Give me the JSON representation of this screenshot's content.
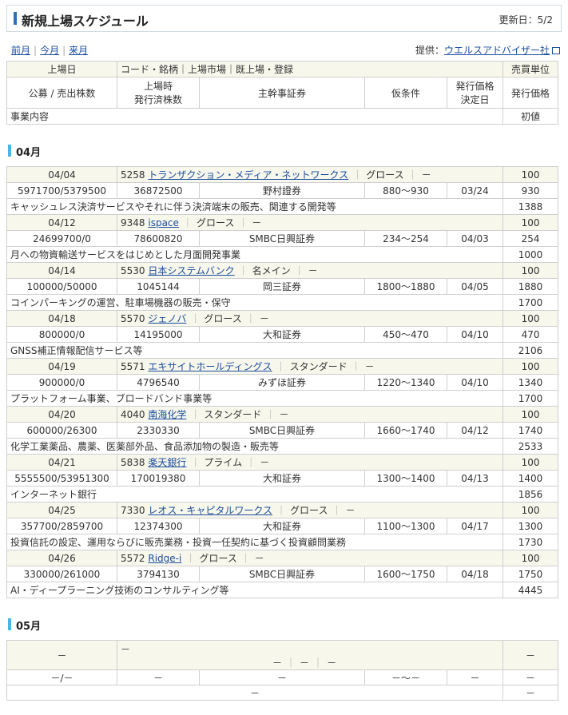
{
  "header": {
    "title": "新規上場スケジュール",
    "updated": "更新日：5/2"
  },
  "nav": {
    "prev": "前月",
    "current": "今月",
    "next": "来月",
    "sep": "|"
  },
  "provider": {
    "prefix": "提供：",
    "name": "ウエルスアドバイザー社"
  },
  "columns": {
    "listing_date": "上場日",
    "code_name": "コード・銘柄｜上場市場｜既上場・登録",
    "trade_unit": "売買単位",
    "offering": "公募 / 売出株数",
    "shares_line1": "上場時",
    "shares_line2": "発行済株数",
    "underwriter": "主幹事証券",
    "provisional": "仮条件",
    "decision_line1": "発行価格",
    "decision_line2": "決定日",
    "issue_price": "発行価格",
    "business": "事業内容",
    "first_price": "初値"
  },
  "months": [
    {
      "label": "04月",
      "ipos": [
        {
          "date": "04/04",
          "code": "5258",
          "name": "トランザクション・メディア・ネットワークス",
          "market": "グロース",
          "status": "－",
          "unit": "100",
          "offering": "5971700/5379500",
          "shares": "36872500",
          "underwriter": "野村證券",
          "range": "880～930",
          "decision": "03/24",
          "price": "930",
          "business": "キャッシュレス決済サービスやそれに伴う決済端末の販売、関連する開発等",
          "first": "1388"
        },
        {
          "date": "04/12",
          "code": "9348",
          "name": "ispace",
          "market": "グロース",
          "status": "－",
          "unit": "100",
          "offering": "24699700/0",
          "shares": "78600820",
          "underwriter": "SMBC日興証券",
          "range": "234～254",
          "decision": "04/03",
          "price": "254",
          "business": "月への物資輸送サービスをはじめとした月面開発事業",
          "first": "1000"
        },
        {
          "date": "04/14",
          "code": "5530",
          "name": "日本システムバンク",
          "market": "名メイン",
          "status": "－",
          "unit": "100",
          "offering": "100000/50000",
          "shares": "1045144",
          "underwriter": "岡三証券",
          "range": "1800～1880",
          "decision": "04/05",
          "price": "1880",
          "business": "コインパーキングの運営、駐車場機器の販売・保守",
          "first": "1700"
        },
        {
          "date": "04/18",
          "code": "5570",
          "name": "ジェノバ",
          "market": "グロース",
          "status": "－",
          "unit": "100",
          "offering": "800000/0",
          "shares": "14195000",
          "underwriter": "大和証券",
          "range": "450～470",
          "decision": "04/10",
          "price": "470",
          "business": "GNSS補正情報配信サービス等",
          "first": "2106"
        },
        {
          "date": "04/19",
          "code": "5571",
          "name": "エキサイトホールディングス",
          "market": "スタンダード",
          "status": "－",
          "unit": "100",
          "offering": "900000/0",
          "shares": "4796540",
          "underwriter": "みずほ証券",
          "range": "1220～1340",
          "decision": "04/10",
          "price": "1340",
          "business": "プラットフォーム事業、ブロードバンド事業等",
          "first": "1700"
        },
        {
          "date": "04/20",
          "code": "4040",
          "name": "南海化学",
          "market": "スタンダード",
          "status": "－",
          "unit": "100",
          "offering": "600000/26300",
          "shares": "2330330",
          "underwriter": "SMBC日興証券",
          "range": "1660～1740",
          "decision": "04/12",
          "price": "1740",
          "business": "化学工業薬品、農薬、医薬部外品、食品添加物の製造・販売等",
          "first": "2533"
        },
        {
          "date": "04/21",
          "code": "5838",
          "name": "楽天銀行",
          "market": "プライム",
          "status": "－",
          "unit": "100",
          "offering": "5555500/53951300",
          "shares": "170019380",
          "underwriter": "大和証券",
          "range": "1300～1400",
          "decision": "04/13",
          "price": "1400",
          "business": "インターネット銀行",
          "first": "1856"
        },
        {
          "date": "04/25",
          "code": "7330",
          "name": "レオス・キャピタルワークス",
          "market": "グロース",
          "status": "－",
          "unit": "100",
          "offering": "357700/2859700",
          "shares": "12374300",
          "underwriter": "大和証券",
          "range": "1100～1300",
          "decision": "04/17",
          "price": "1300",
          "business": "投資信託の設定、運用ならびに販売業務・投資一任契約に基づく投資顧問業務",
          "first": "1730"
        },
        {
          "date": "04/26",
          "code": "5572",
          "name": "Ridge-i",
          "market": "グロース",
          "status": "－",
          "unit": "100",
          "offering": "330000/261000",
          "shares": "3794130",
          "underwriter": "SMBC日興証券",
          "range": "1600～1750",
          "decision": "04/18",
          "price": "1750",
          "business": "AI・ディープラーニング技術のコンサルティング等",
          "first": "4445"
        }
      ]
    }
  ],
  "may": {
    "label": "05月",
    "date": "－",
    "code": "－",
    "market": "－",
    "status": "－",
    "extra": "－",
    "unit": "－",
    "offering": "－/－",
    "shares": "－",
    "underwriter": "－",
    "range": "－～－",
    "decision": "－",
    "price": "－",
    "business": "－",
    "first": "－"
  }
}
